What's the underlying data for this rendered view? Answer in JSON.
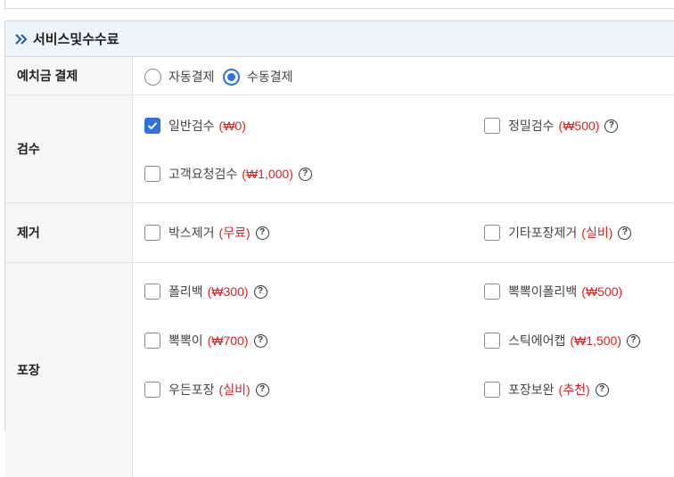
{
  "section": {
    "title": "서비스및수수료"
  },
  "payment": {
    "label": "예치금 결제",
    "options": [
      {
        "text": "자동결제",
        "selected": false
      },
      {
        "text": "수동결제",
        "selected": true
      }
    ]
  },
  "inspection": {
    "label": "검수",
    "options": [
      {
        "text": "일반검수",
        "price": "(₩0)",
        "checked": true,
        "help": false
      },
      {
        "text": "정밀검수",
        "price": "(₩500)",
        "checked": false,
        "help": true
      },
      {
        "text": "고객요청검수",
        "price": "(₩1,000)",
        "checked": false,
        "help": true
      }
    ]
  },
  "removal": {
    "label": "제거",
    "options": [
      {
        "text": "박스제거",
        "price": "(무료)",
        "checked": false,
        "help": true
      },
      {
        "text": "기타포장제거",
        "price": "(실비)",
        "checked": false,
        "help": true
      }
    ]
  },
  "packaging": {
    "label": "포장",
    "options": [
      {
        "text": "폴리백",
        "price": "(₩300)",
        "checked": false,
        "help": true
      },
      {
        "text": "뽁뽁이폴리백",
        "price": "(₩500)",
        "checked": false,
        "help": false
      },
      {
        "text": "뽁뽁이",
        "price": "(₩700)",
        "checked": false,
        "help": true
      },
      {
        "text": "스틱에어캡",
        "price": "(₩1,500)",
        "checked": false,
        "help": true
      },
      {
        "text": "우든포장",
        "price": "(실비)",
        "checked": false,
        "help": true
      },
      {
        "text": "포장보완",
        "price": "(추천)",
        "checked": false,
        "help": true
      }
    ]
  },
  "colors": {
    "accent": "#2f6fe0",
    "price": "#e02020",
    "header_bg": "#eef4fb",
    "label_bg": "#f6f6f6"
  }
}
